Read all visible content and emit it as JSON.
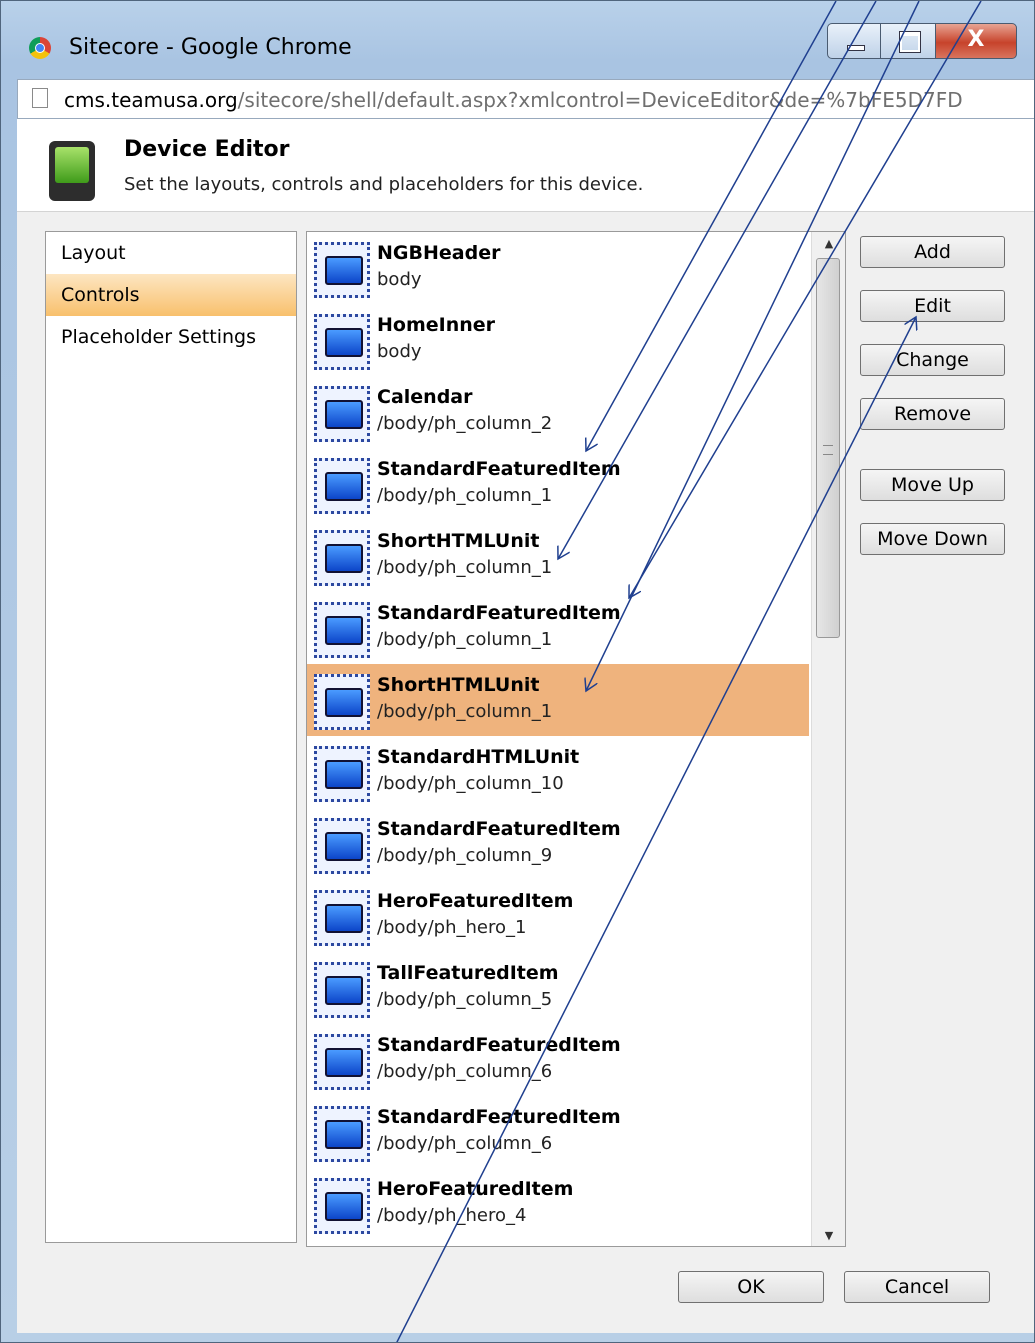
{
  "window": {
    "title": "Sitecore - Google Chrome",
    "close_glyph": "X"
  },
  "browser": {
    "url_host": "cms.teamusa.org",
    "url_path": "/sitecore/shell/default.aspx?xmlcontrol=DeviceEditor&de=%7bFE5D7FD"
  },
  "dialog": {
    "title": "Device Editor",
    "subtitle": "Set the layouts, controls and placeholders for this device."
  },
  "nav": {
    "items": [
      {
        "label": "Layout"
      },
      {
        "label": "Controls"
      },
      {
        "label": "Placeholder Settings"
      }
    ],
    "selected": "Controls"
  },
  "controls": [
    {
      "name": "NGBHeader",
      "placeholder": "body"
    },
    {
      "name": "HomeInner",
      "placeholder": "body"
    },
    {
      "name": "Calendar",
      "placeholder": "/body/ph_column_2"
    },
    {
      "name": "StandardFeaturedItem",
      "placeholder": "/body/ph_column_1"
    },
    {
      "name": "ShortHTMLUnit",
      "placeholder": "/body/ph_column_1"
    },
    {
      "name": "StandardFeaturedItem",
      "placeholder": "/body/ph_column_1"
    },
    {
      "name": "ShortHTMLUnit",
      "placeholder": "/body/ph_column_1"
    },
    {
      "name": "StandardHTMLUnit",
      "placeholder": "/body/ph_column_10"
    },
    {
      "name": "StandardFeaturedItem",
      "placeholder": "/body/ph_column_9"
    },
    {
      "name": "HeroFeaturedItem",
      "placeholder": "/body/ph_hero_1"
    },
    {
      "name": "TallFeaturedItem",
      "placeholder": "/body/ph_column_5"
    },
    {
      "name": "StandardFeaturedItem",
      "placeholder": "/body/ph_column_6"
    },
    {
      "name": "StandardFeaturedItem",
      "placeholder": "/body/ph_column_6"
    },
    {
      "name": "HeroFeaturedItem",
      "placeholder": "/body/ph_hero_4"
    }
  ],
  "selected_control_index": 6,
  "buttons": {
    "add": "Add",
    "edit": "Edit",
    "change": "Change",
    "remove": "Remove",
    "move_up": "Move Up",
    "move_down": "Move Down",
    "ok": "OK",
    "cancel": "Cancel"
  },
  "scrollbar": {
    "up_glyph": "▲",
    "down_glyph": "▼",
    "grip_glyph": "≡"
  },
  "colors": {
    "selected_row": "#efb37d",
    "active_nav": "#f8c06c",
    "annotation_line": "#1f3f8f"
  }
}
